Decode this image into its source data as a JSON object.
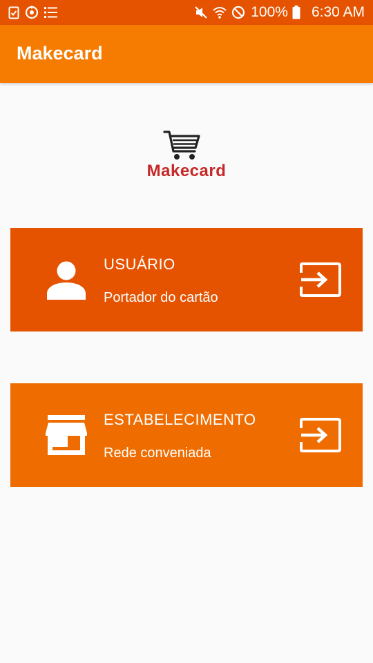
{
  "status_bar": {
    "battery": "100%",
    "time": "6:30 AM",
    "icons": [
      "clipboard-check-icon",
      "timer-icon",
      "list-icon",
      "mute-icon",
      "wifi-icon",
      "do-not-disturb-icon",
      "battery-icon"
    ]
  },
  "app_bar": {
    "title": "Makecard"
  },
  "logo": {
    "text": "Makecard",
    "icon": "shopping-cart-icon"
  },
  "options": [
    {
      "title": "USUÁRIO",
      "subtitle": "Portador do cartão",
      "icon": "person-icon",
      "action_icon": "login-icon",
      "color": "#e55300"
    },
    {
      "title": "ESTABELECIMENTO",
      "subtitle": "Rede conveniada",
      "icon": "store-icon",
      "action_icon": "login-icon",
      "color": "#ef6c00"
    }
  ],
  "colors": {
    "status_bar": "#e55300",
    "app_bar": "#f57c00",
    "logo_text": "#c62828",
    "background": "#fafafa"
  }
}
